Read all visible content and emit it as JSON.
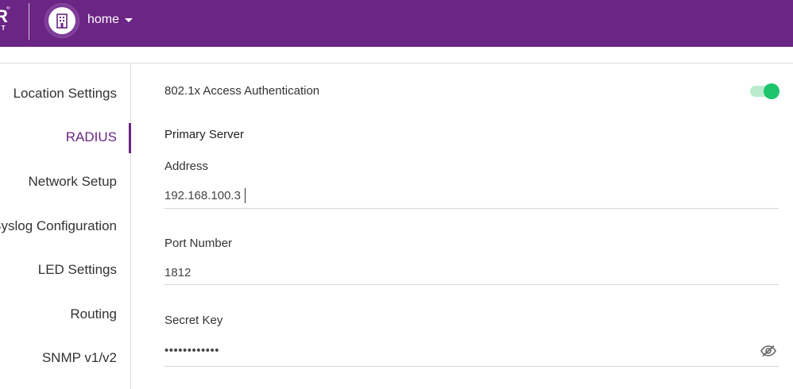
{
  "header": {
    "logo_text": "R",
    "logo_sub": "HT",
    "logo_mark": "®",
    "location_icon": "building-icon",
    "location_name": "home",
    "dropdown_icon": "caret-down-icon"
  },
  "sidebar": {
    "items": [
      {
        "label": "Location Settings",
        "active": false
      },
      {
        "label": "RADIUS",
        "active": true
      },
      {
        "label": "Network Setup",
        "active": false
      },
      {
        "label": "Syslog Configuration",
        "active": false
      },
      {
        "label": "LED Settings",
        "active": false
      },
      {
        "label": "Routing",
        "active": false
      },
      {
        "label": "SNMP v1/v2",
        "active": false
      }
    ]
  },
  "radius": {
    "auth_label": "802.1x Access Authentication",
    "auth_enabled": true,
    "primary_server_title": "Primary Server",
    "address_label": "Address",
    "address_value": "192.168.100.3",
    "port_label": "Port Number",
    "port_value": "1812",
    "secret_label": "Secret Key",
    "secret_value": "••••••••••••",
    "visibility_icon": "eye-slash-icon"
  },
  "colors": {
    "brand": "#6b2585",
    "toggle_on": "#1ec56b",
    "toggle_track": "#b9eccd"
  }
}
